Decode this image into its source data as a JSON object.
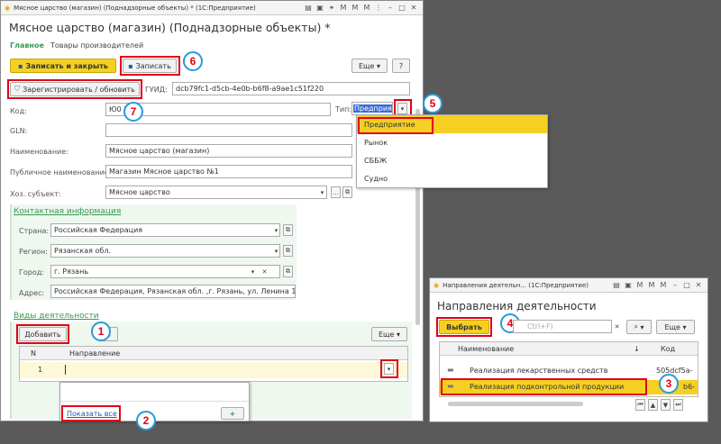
{
  "main_window": {
    "title": "Мясное царство (магазин) (Поднадзорные объекты) * (1С:Предприятие)",
    "heading": "Мясное царство (магазин) (Поднадзорные объекты) *",
    "tab_main": "Главное",
    "tab_goods": "Товары производителей",
    "btn_save_close": "Записать и закрыть",
    "btn_save": "Записать",
    "btn_more": "Еще",
    "btn_help": "?",
    "btn_register": "Зарегистрировать / обновить",
    "guid_label": "ГУИД:",
    "guid_value": "dcb79fc1-d5cb-4e0b-b6f8-a9ae1c51f220",
    "code_label": "Код:",
    "code_value": "Ю0     7",
    "type_label": "Тип:",
    "type_value": "Предприятие",
    "gln_label": "GLN:",
    "name_label": "Наименование:",
    "name_value": "Мясное царство (магазин)",
    "public_label": "Публичное наименование:",
    "public_value": "Магазин Мясное царство №1",
    "subject_label": "Хоз. субъект:",
    "subject_value": "Мясное царство",
    "contact_header": "Контактная информация",
    "country_label": "Страна:",
    "country_value": "Российская Федерация",
    "region_label": "Регион:",
    "region_value": "Рязанская обл.",
    "city_label": "Город:",
    "city_value": "г. Рязань",
    "address_label": "Адрес:",
    "address_value": "Российская Федерация, Рязанская обл. ,г. Рязань, ул. Ленина 15",
    "activities_header": "Виды деятельности",
    "btn_add": "Добавить",
    "btn_more2": "Еще",
    "col_n": "N",
    "col_direction": "Направление",
    "row_n": "1",
    "show_all": "Показать все",
    "type_options": [
      "Предприятие",
      "Рынок",
      "СББЖ",
      "Судно"
    ]
  },
  "dialog": {
    "title": "Направления деятельн... (1С:Предприятие)",
    "heading": "Направления деятельности",
    "btn_select": "Выбрать",
    "search_placeholder": "Ctrl+F)",
    "btn_more": "Еще",
    "col_name": "Наименование",
    "col_code": "Код",
    "sort_arrow": "↓",
    "rows": [
      {
        "name": "Реализация лекарственных средств",
        "code": "505dcf5a-"
      },
      {
        "name": "Реализация подконтрольной продукции",
        "code": "b6-"
      }
    ]
  },
  "markers": [
    "1",
    "2",
    "3",
    "4",
    "5",
    "6",
    "7"
  ]
}
